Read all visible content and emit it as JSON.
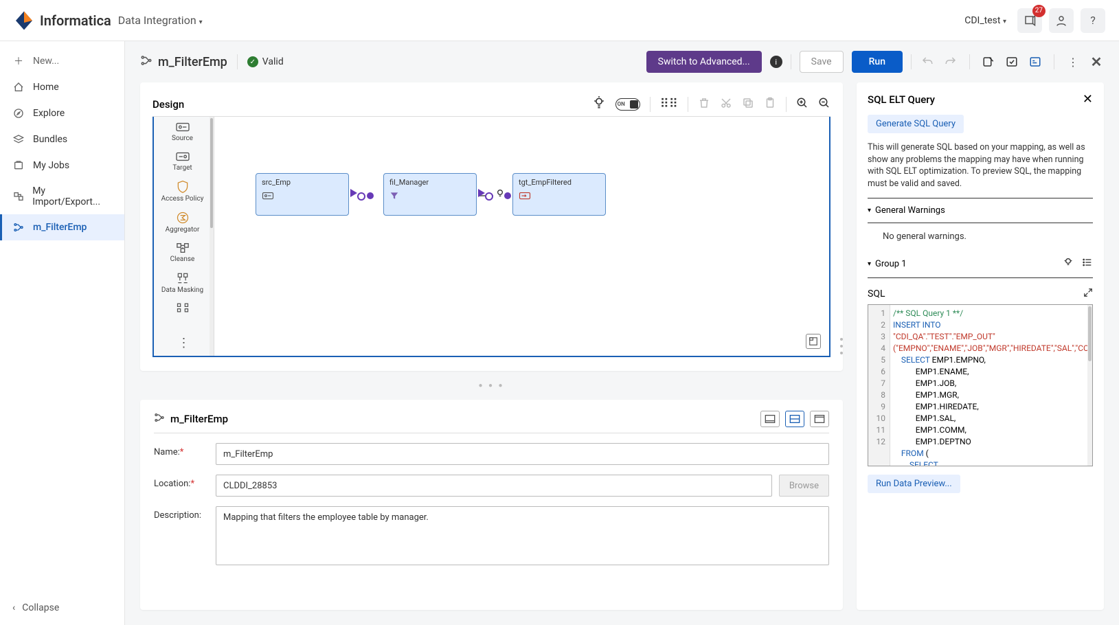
{
  "topbar": {
    "brand": "Informatica",
    "app": "Data Integration",
    "workspace": "CDI_test",
    "notif_count": "27"
  },
  "sidebar": {
    "new": "New...",
    "items": [
      {
        "label": "Home"
      },
      {
        "label": "Explore"
      },
      {
        "label": "Bundles"
      },
      {
        "label": "My Jobs"
      },
      {
        "label": "My Import/Export..."
      }
    ],
    "active": "m_FilterEmp",
    "collapse": "Collapse"
  },
  "header": {
    "title": "m_FilterEmp",
    "state": "Valid",
    "switch": "Switch to Advanced...",
    "save": "Save",
    "run": "Run"
  },
  "design": {
    "title": "Design",
    "toggle": "ON",
    "palette": [
      "Source",
      "Target",
      "Access Policy",
      "Aggregator",
      "Cleanse",
      "Data Masking"
    ],
    "nodes": {
      "src": "src_Emp",
      "fil": "fil_Manager",
      "tgt": "tgt_EmpFiltered"
    }
  },
  "props": {
    "tab_title": "m_FilterEmp",
    "name_label": "Name:",
    "name_value": "m_FilterEmp",
    "loc_label": "Location:",
    "loc_value": "CLDDI_28853",
    "browse": "Browse",
    "desc_label": "Description:",
    "desc_value": "Mapping that filters the employee table by manager."
  },
  "right": {
    "title": "SQL ELT Query",
    "gen_btn": "Generate SQL Query",
    "desc": "This will generate SQL based on your mapping, as well as show any problems the mapping may have when running with SQL ELT optimization. To preview SQL, the mapping must be valid and saved.",
    "warn_hdr": "General Warnings",
    "warn_msg": "No general warnings.",
    "group": "Group 1",
    "sql_label": "SQL",
    "preview_btn": "Run Data Preview...",
    "code_lines": [
      "1",
      "2",
      "3",
      "4",
      "5",
      "6",
      "7",
      "8",
      "9",
      "10",
      "11",
      "12"
    ],
    "code": {
      "l1": "/** SQL Query 1 **/",
      "l2a": "INSERT INTO",
      "l2b": "\"CDI_QA\".\"TEST\".\"EMP_OUT\"",
      "l2c": "(\"EMPNO\",\"ENAME\",\"JOB\",\"MGR\",\"HIREDATE\",\"SAL\",\"COMM\",\"DEPTNO\")",
      "l3a": "    SELECT",
      "l3b": " EMP1.EMPNO,",
      "l4": "           EMP1.ENAME,",
      "l5": "           EMP1.JOB,",
      "l6": "           EMP1.MGR,",
      "l7": "           EMP1.HIREDATE,",
      "l8": "           EMP1.SAL,",
      "l9": "           EMP1.COMM,",
      "l10": "           EMP1.DEPTNO",
      "l11a": "    FROM",
      "l11b": " (",
      "l12": "        SELECT"
    }
  }
}
